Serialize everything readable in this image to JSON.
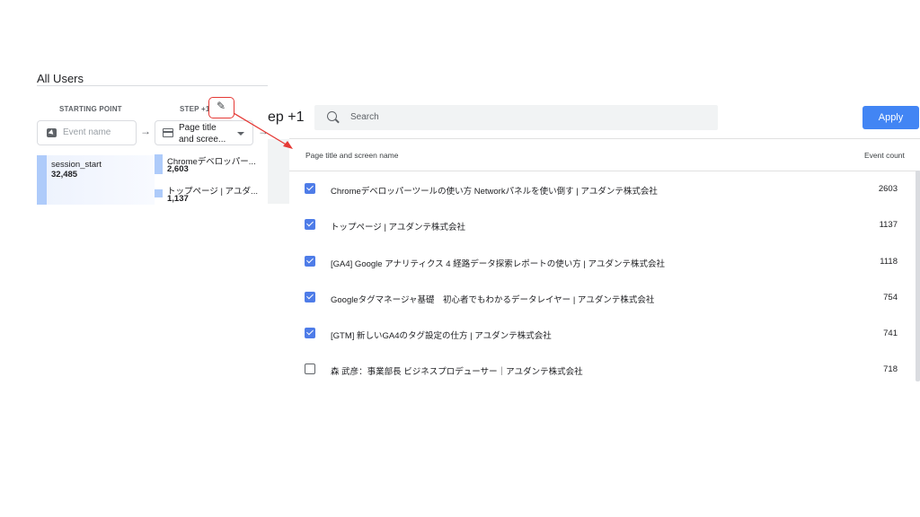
{
  "segment": "All Users",
  "starting_point": {
    "header": "STARTING POINT",
    "placeholder": "Event name",
    "node": {
      "title": "session_start",
      "value": "32,485"
    }
  },
  "step": {
    "header": "STEP +1",
    "label_line1": "Page title",
    "label_line2": "and scree...",
    "nodes": [
      {
        "title": "Chromeデベロッパー...",
        "value": "2,603"
      },
      {
        "title": "トップページ | アユダ...",
        "value": "1,137"
      }
    ]
  },
  "popup": {
    "title": "ep +1",
    "search_placeholder": "Search",
    "apply_label": "Apply",
    "col_dimension": "Page title and screen name",
    "col_metric": "Event count",
    "rows": [
      {
        "label": "Chromeデベロッパーツールの使い方 Networkパネルを使い倒す | アユダンテ株式会社",
        "count": "2603",
        "checked": true
      },
      {
        "label": "トップページ | アユダンテ株式会社",
        "count": "1137",
        "checked": true
      },
      {
        "label": "[GA4] Google アナリティクス 4 経路データ探索レポートの使い方 | アユダンテ株式会社",
        "count": "1118",
        "checked": true
      },
      {
        "label": "Googleタグマネージャ基礎　初心者でもわかるデータレイヤー | アユダンテ株式会社",
        "count": "754",
        "checked": true
      },
      {
        "label": "[GTM] 新しいGA4のタグ設定の仕方 | アユダンテ株式会社",
        "count": "741",
        "checked": true
      },
      {
        "label": "森 武彦：事業部長 ビジネスプロデューサー｜アユダンテ株式会社",
        "count": "718",
        "checked": false
      }
    ]
  },
  "icons": [
    "event-icon",
    "page-icon",
    "pencil-icon",
    "search-icon",
    "checkbox-icon"
  ],
  "colors": {
    "accent": "#4285f4",
    "checkbox": "#4e7ce8",
    "highlight": "#e53935",
    "node_bar": "#aecbfa"
  }
}
